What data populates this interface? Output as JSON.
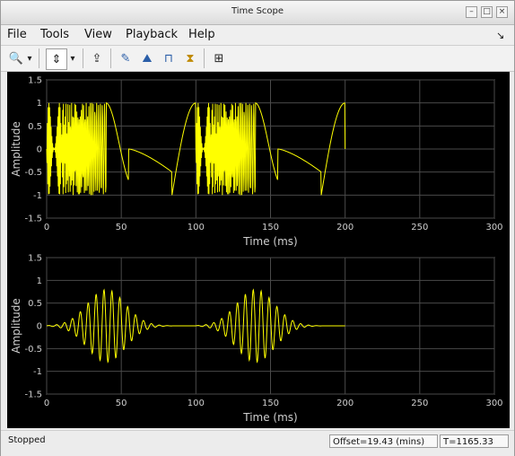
{
  "window": {
    "title": "Time Scope",
    "buttons": {
      "minimize": "–",
      "maximize": "□",
      "close": "×"
    }
  },
  "menu": [
    {
      "label": "File",
      "mnemonic": "F"
    },
    {
      "label": "Tools",
      "mnemonic": "T"
    },
    {
      "label": "View",
      "mnemonic": "V"
    },
    {
      "label": "Playback",
      "mnemonic": "P"
    },
    {
      "label": "Help",
      "mnemonic": "H"
    }
  ],
  "toolbar_icons": [
    "zoom-in-icon",
    "zoom-dropdown-icon",
    "scale-axes-icon",
    "scale-dropdown-icon",
    "restore-settings-icon",
    "edit-signal-icon",
    "peak-finder-icon",
    "bilevel-measurements-icon",
    "cursor-measurements-icon",
    "layout-icon"
  ],
  "plots": [
    {
      "ylabel": "Amplitude",
      "xlabel": "Time (ms)",
      "yticks": [
        "1.5",
        "1",
        "0.5",
        "0",
        "-0.5",
        "-1",
        "-1.5"
      ],
      "xticks": [
        "0",
        "50",
        "100",
        "150",
        "200",
        "250",
        "300"
      ],
      "chart_data": {
        "type": "line",
        "x_range_ms": [
          0,
          300
        ],
        "y_range": [
          -1.5,
          1.5
        ],
        "signal_end_ms": 200,
        "series": [
          {
            "color": "#ffff00",
            "description": "chirp-like signal, amplitude about 1, period 100 ms"
          }
        ]
      }
    },
    {
      "ylabel": "Amplitude",
      "xlabel": "Time (ms)",
      "yticks": [
        "1.5",
        "1",
        "0.5",
        "0",
        "-0.5",
        "-1",
        "-1.5"
      ],
      "xticks": [
        "0",
        "50",
        "100",
        "150",
        "200",
        "250",
        "300"
      ],
      "chart_data": {
        "type": "line",
        "x_range_ms": [
          0,
          300
        ],
        "y_range": [
          -1.5,
          1.5
        ],
        "signal_end_ms": 200,
        "series": [
          {
            "color": "#ffff00",
            "description": "windowed bursts peaking about 0.8 near 40 ms and 140 ms"
          }
        ]
      }
    }
  ],
  "status": {
    "text": "Stopped",
    "offset": "Offset=19.43 (mins)",
    "time": "T=1165.33"
  }
}
